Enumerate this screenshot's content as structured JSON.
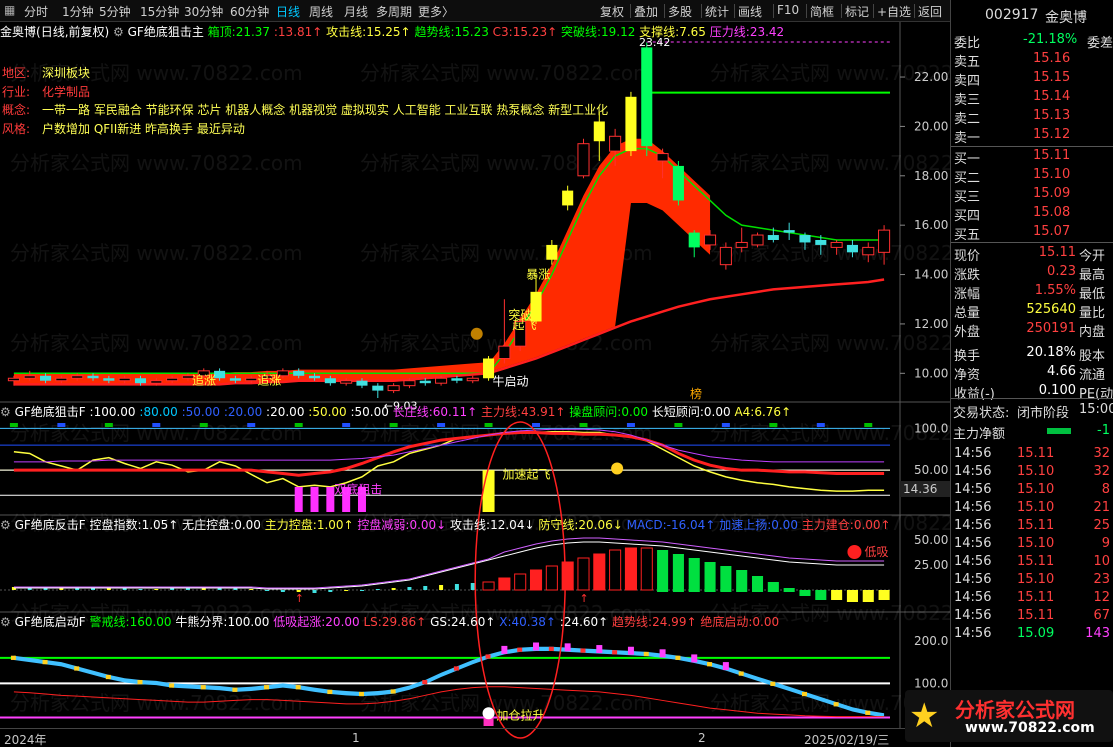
{
  "toolbar": {
    "periods": [
      "分时",
      "1分钟",
      "5分钟",
      "15分钟",
      "30分钟",
      "60分钟",
      "日线",
      "周线",
      "月线",
      "多周期",
      "更多〉"
    ],
    "active_period": "日线",
    "right_buttons": [
      "复权",
      "叠加",
      "多股",
      "统计",
      "画线",
      "F10",
      "简框",
      "标记",
      "+自选",
      "返回"
    ]
  },
  "main_chart": {
    "stock_name": "金奥博",
    "mode": "(日线,前复权)",
    "indicator": "GF绝底狙击主",
    "params": [
      {
        "label": "箱顶:",
        "value": "21.37",
        "color": "#00ff00"
      },
      {
        "label": ":",
        "value": "13.81↑",
        "color": "#ff4040"
      },
      {
        "label": "攻击线:",
        "value": "15.25↑",
        "color": "#ffff40"
      },
      {
        "label": "趋势线:",
        "value": "15.23",
        "color": "#00ff00"
      },
      {
        "label": "C3:",
        "value": "15.23↑",
        "color": "#ff4040"
      },
      {
        "label": "突破线:",
        "value": "19.12",
        "color": "#00ff00"
      },
      {
        "label": "支撑线:",
        "value": "7.65",
        "color": "#ffff40"
      },
      {
        "label": "压力线:",
        "value": "23.42",
        "color": "#ff40ff"
      }
    ],
    "info": [
      {
        "label": "地区:",
        "value": "深圳板块"
      },
      {
        "label": "行业:",
        "value": "化学制品",
        "value_color": "#ff3b3b"
      },
      {
        "label": "概念:",
        "value": "一带一路 军民融合 节能环保 芯片 机器人概念 机器视觉 虚拟现实 人工智能 工业互联 热泵概念 新型工业化"
      },
      {
        "label": "风格:",
        "value": "户数增加 QFII新进 昨高换手 最近异动"
      }
    ],
    "y_ticks": [
      "22.00",
      "20.00",
      "18.00",
      "16.00",
      "14.00",
      "12.00",
      "10.00"
    ],
    "annotations": {
      "high": "23.42",
      "low": "←9.03",
      "baozhang": "暴涨",
      "tupo": "突破",
      "qifei": "起飞",
      "niuqidong": "牛启动",
      "zhuizhang1": "追涨",
      "zhuizhang2": "追涨",
      "bang": "榜"
    }
  },
  "ind1": {
    "name": "GF绝底狙击F",
    "params": [
      {
        "label": ":",
        "value": "100.00",
        "color": "#ffffff"
      },
      {
        "label": ":",
        "value": "80.00",
        "color": "#00c8ff"
      },
      {
        "label": ":",
        "value": "50.00",
        "color": "#3060ff"
      },
      {
        "label": ":",
        "value": "20.00",
        "color": "#3060ff"
      },
      {
        "label": ":",
        "value": "20.00",
        "color": "#ffffff"
      },
      {
        "label": ":",
        "value": "50.00",
        "color": "#ffff40"
      },
      {
        "label": ":",
        "value": "50.00",
        "color": "#ffffff"
      },
      {
        "label": "长庄线:",
        "value": "60.11↑",
        "color": "#ff40ff"
      },
      {
        "label": "主力线:",
        "value": "43.91↑",
        "color": "#ff4040"
      },
      {
        "label": "操盘顾问:",
        "value": "0.00",
        "color": "#00ff00"
      },
      {
        "label": "长短顾问:",
        "value": "0.00",
        "color": "#ffffff"
      },
      {
        "label": "A4:",
        "value": "6.76↑",
        "color": "#ffff40"
      }
    ],
    "y_ticks": [
      "100.0",
      "50.00",
      "14.36"
    ],
    "annotations": {
      "shuangdi": "双底狙击",
      "jiasu": "加速起飞"
    }
  },
  "ind2": {
    "name": "GF绝底反击F",
    "params": [
      {
        "label": "控盘指数:",
        "value": "1.05↑",
        "color": "#ffffff"
      },
      {
        "label": "无庄控盘:",
        "value": "0.00",
        "color": "#ffffff"
      },
      {
        "label": "主力控盘:",
        "value": "1.00↑",
        "color": "#ffff40"
      },
      {
        "label": "控盘减弱:",
        "value": "0.00↓",
        "color": "#ff40ff"
      },
      {
        "label": "攻击线:",
        "value": "12.04↓",
        "color": "#ffffff"
      },
      {
        "label": "防守线:",
        "value": "20.06↓",
        "color": "#ffff40"
      },
      {
        "label": "MACD:",
        "value": "-16.04↑",
        "color": "#3060ff"
      },
      {
        "label": "加速上扬:",
        "value": "0.00",
        "color": "#3060ff"
      },
      {
        "label": "主力建仓:",
        "value": "0.00↑",
        "color": "#ff4040"
      }
    ],
    "y_ticks": [
      "50.00",
      "25.00"
    ],
    "annotations": {
      "dixi": "低吸"
    }
  },
  "ind3": {
    "name": "GF绝底启动F",
    "params": [
      {
        "label": "警戒线:",
        "value": "160.00",
        "color": "#00ff00"
      },
      {
        "label": "牛熊分界:",
        "value": "100.00",
        "color": "#ffffff"
      },
      {
        "label": "低吸起涨:",
        "value": "20.00",
        "color": "#ff40ff"
      },
      {
        "label": "LS:",
        "value": "29.86↑",
        "color": "#ff4040"
      },
      {
        "label": "GS:",
        "value": "24.60↑",
        "color": "#ffffff"
      },
      {
        "label": "X:",
        "value": "40.38↑",
        "color": "#3060ff"
      },
      {
        "label": ":",
        "value": "24.60↑",
        "color": "#ffffff"
      },
      {
        "label": "趋势线:",
        "value": "24.99↑",
        "color": "#ff4040"
      },
      {
        "label": "绝底启动:",
        "value": "0.00",
        "color": "#ff4040"
      }
    ],
    "y_ticks": [
      "200.0",
      "100.0"
    ],
    "annotations": {
      "jiacang": "加仓拉升"
    }
  },
  "x_axis": {
    "labels": [
      "2024年",
      "1",
      "2",
      "2025/02/19/三"
    ]
  },
  "watermark": "分析家公式网 www.70822.com",
  "right_panel": {
    "code": "002917",
    "name": "金奥博",
    "weibi_label": "委比",
    "weibi_value": "-21.18%",
    "weicha_label": "委差",
    "asks": [
      {
        "label": "卖五",
        "price": "15.16"
      },
      {
        "label": "卖四",
        "price": "15.15"
      },
      {
        "label": "卖三",
        "price": "15.14"
      },
      {
        "label": "卖二",
        "price": "15.13"
      },
      {
        "label": "卖一",
        "price": "15.12"
      }
    ],
    "bids": [
      {
        "label": "买一",
        "price": "15.11"
      },
      {
        "label": "买二",
        "price": "15.10"
      },
      {
        "label": "买三",
        "price": "15.09"
      },
      {
        "label": "买四",
        "price": "15.08"
      },
      {
        "label": "买五",
        "price": "15.07"
      }
    ],
    "stats": [
      {
        "label": "现价",
        "value": "15.11",
        "color": "#ff4040",
        "label2": "今开"
      },
      {
        "label": "涨跌",
        "value": "0.23",
        "color": "#ff4040",
        "label2": "最高"
      },
      {
        "label": "涨幅",
        "value": "1.55%",
        "color": "#ff4040",
        "label2": "最低"
      },
      {
        "label": "总量",
        "value": "525640",
        "color": "#ffff40",
        "label2": "量比"
      },
      {
        "label": "外盘",
        "value": "250191",
        "color": "#ff4040",
        "label2": "内盘"
      },
      {
        "label": "换手",
        "value": "20.18%",
        "color": "#ffffff",
        "label2": "股本"
      },
      {
        "label": "净资",
        "value": "4.66",
        "color": "#ffffff",
        "label2": "流通"
      },
      {
        "label": "收益(-)",
        "value": "0.100",
        "color": "#ffffff",
        "label2": "PE(动"
      }
    ],
    "trade_status_label": "交易状态:",
    "trade_status_value": "闭市阶段",
    "trade_time": "15:00",
    "net_inflow_label": "主力净额",
    "net_inflow_value": "-1",
    "ticks": [
      {
        "time": "14:56",
        "price": "15.11",
        "vol": "32"
      },
      {
        "time": "14:56",
        "price": "15.10",
        "vol": "32"
      },
      {
        "time": "14:56",
        "price": "15.10",
        "vol": "8"
      },
      {
        "time": "14:56",
        "price": "15.10",
        "vol": "21"
      },
      {
        "time": "14:56",
        "price": "15.11",
        "vol": "25"
      },
      {
        "time": "14:56",
        "price": "15.10",
        "vol": "9"
      },
      {
        "time": "14:56",
        "price": "15.11",
        "vol": "10"
      },
      {
        "time": "14:56",
        "price": "15.10",
        "vol": "23"
      },
      {
        "time": "14:56",
        "price": "15.11",
        "vol": "12"
      },
      {
        "time": "14:56",
        "price": "15.11",
        "vol": "67"
      },
      {
        "time": "14:56",
        "price": "15.09",
        "vol": "143"
      }
    ],
    "logo_text": "分析家公式网",
    "logo_url": "www.70822.com"
  },
  "chart_data": {
    "type": "candlestick",
    "ylim": [
      9.0,
      23.5
    ],
    "candles": [
      [
        9.7,
        9.8,
        9.5,
        9.9
      ],
      [
        9.8,
        9.9,
        9.7,
        10.1
      ],
      [
        9.9,
        9.7,
        9.6,
        10.0
      ],
      [
        9.7,
        9.8,
        9.6,
        9.9
      ],
      [
        9.8,
        9.9,
        9.7,
        10.0
      ],
      [
        9.9,
        9.8,
        9.7,
        10.0
      ],
      [
        9.8,
        9.7,
        9.6,
        9.9
      ],
      [
        9.7,
        9.8,
        9.6,
        9.9
      ],
      [
        9.8,
        9.6,
        9.5,
        9.9
      ],
      [
        9.6,
        9.7,
        9.5,
        9.8
      ],
      [
        9.7,
        9.8,
        9.6,
        9.9
      ],
      [
        9.8,
        9.9,
        9.7,
        10.0
      ],
      [
        9.9,
        10.1,
        9.8,
        10.2
      ],
      [
        10.1,
        9.8,
        9.7,
        10.2
      ],
      [
        9.8,
        9.7,
        9.6,
        9.9
      ],
      [
        9.7,
        9.8,
        9.6,
        9.9
      ],
      [
        9.8,
        9.9,
        9.7,
        10.1
      ],
      [
        9.9,
        10.1,
        9.8,
        10.2
      ],
      [
        10.1,
        9.9,
        9.8,
        10.2
      ],
      [
        9.9,
        9.8,
        9.7,
        10.0
      ],
      [
        9.8,
        9.6,
        9.5,
        9.9
      ],
      [
        9.6,
        9.7,
        9.5,
        9.8
      ],
      [
        9.7,
        9.5,
        9.4,
        9.8
      ],
      [
        9.5,
        9.3,
        9.0,
        9.6
      ],
      [
        9.3,
        9.5,
        9.2,
        9.6
      ],
      [
        9.5,
        9.7,
        9.4,
        9.8
      ],
      [
        9.7,
        9.6,
        9.5,
        9.8
      ],
      [
        9.6,
        9.8,
        9.5,
        9.9
      ],
      [
        9.8,
        9.7,
        9.6,
        9.9
      ],
      [
        9.7,
        9.8,
        9.6,
        9.9
      ],
      [
        9.8,
        10.6,
        9.7,
        10.7
      ],
      [
        10.6,
        11.1,
        10.4,
        13.0
      ],
      [
        11.1,
        12.1,
        10.9,
        12.3
      ],
      [
        12.1,
        13.3,
        12.0,
        14.0
      ],
      [
        14.6,
        15.2,
        14.4,
        15.4
      ],
      [
        16.8,
        17.4,
        16.6,
        17.6
      ],
      [
        18.0,
        19.3,
        17.9,
        19.5
      ],
      [
        19.4,
        20.2,
        18.6,
        20.6
      ],
      [
        19.0,
        19.6,
        18.4,
        19.9
      ],
      [
        21.2,
        19.0,
        18.8,
        21.4
      ],
      [
        23.2,
        19.2,
        18.8,
        23.4
      ],
      [
        18.6,
        18.9,
        17.9,
        19.1
      ],
      [
        18.4,
        17.0,
        16.8,
        18.6
      ],
      [
        15.7,
        15.1,
        14.7,
        15.8
      ],
      [
        15.2,
        15.6,
        15.0,
        15.8
      ],
      [
        14.4,
        15.1,
        14.2,
        15.3
      ],
      [
        15.1,
        15.3,
        14.9,
        15.9
      ],
      [
        15.2,
        15.6,
        15.1,
        15.7
      ],
      [
        15.6,
        15.4,
        15.3,
        15.9
      ],
      [
        15.8,
        15.7,
        15.4,
        16.1
      ],
      [
        15.6,
        15.3,
        15.0,
        15.7
      ],
      [
        15.4,
        15.2,
        14.8,
        15.6
      ],
      [
        15.1,
        15.3,
        14.8,
        15.4
      ],
      [
        15.2,
        14.9,
        14.7,
        15.4
      ],
      [
        14.8,
        15.1,
        14.5,
        15.3
      ],
      [
        14.9,
        15.8,
        14.4,
        16.0
      ]
    ],
    "ma_green": [
      10.0,
      10.0,
      10.0,
      10.0,
      10.0,
      10.0,
      10.0,
      10.0,
      10.0,
      10.0,
      10.0,
      10.0,
      10.0,
      10.0,
      10.0,
      10.0,
      10.0,
      10.0,
      10.0,
      10.0,
      10.0,
      10.0,
      10.0,
      10.0,
      10.0,
      10.0,
      10.0,
      10.0,
      10.0,
      10.0,
      10.0,
      10.8,
      11.8,
      12.8,
      14.0,
      15.4,
      16.8,
      18.0,
      18.8,
      19.1,
      19.1,
      18.8,
      18.2,
      17.6,
      17.0,
      16.4,
      16.0,
      15.9,
      15.8,
      15.7,
      15.6,
      15.5,
      15.4,
      15.4,
      15.4,
      15.4
    ],
    "ma_red": [
      9.55,
      9.55,
      9.55,
      9.55,
      9.55,
      9.55,
      9.55,
      9.55,
      9.55,
      9.55,
      9.55,
      9.55,
      9.55,
      9.55,
      9.6,
      9.6,
      9.65,
      9.65,
      9.7,
      9.7,
      9.7,
      9.7,
      9.7,
      9.7,
      9.7,
      9.75,
      9.8,
      9.85,
      9.9,
      9.95,
      10.0,
      10.2,
      10.4,
      10.6,
      10.85,
      11.1,
      11.35,
      11.6,
      11.85,
      12.1,
      12.3,
      12.5,
      12.7,
      12.85,
      13.0,
      13.1,
      13.2,
      13.3,
      13.4,
      13.45,
      13.5,
      13.55,
      13.6,
      13.65,
      13.7,
      13.8
    ],
    "box_top": 21.37
  }
}
